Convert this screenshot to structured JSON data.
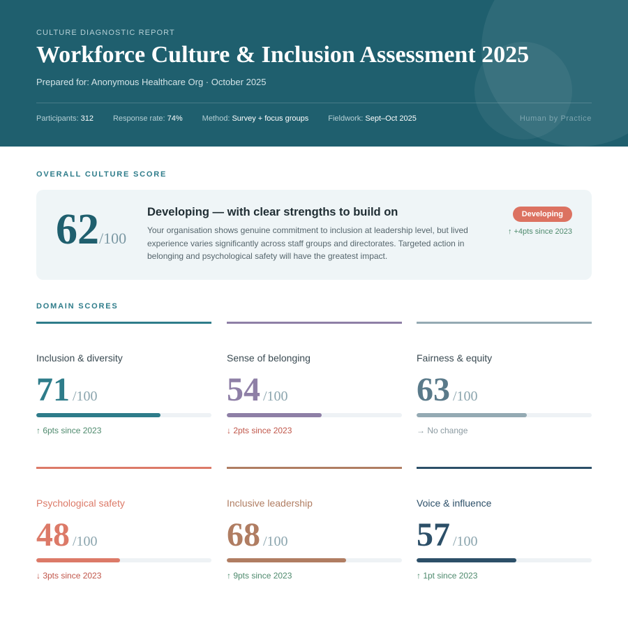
{
  "header": {
    "eyebrow": "CULTURE DIAGNOSTIC REPORT",
    "title": "Workforce Culture & Inclusion Assessment 2025",
    "prepared": "Prepared for: Anonymous Healthcare Org · October 2025",
    "meta": [
      {
        "label": "Participants:",
        "value": "312"
      },
      {
        "label": "Response rate:",
        "value": "74%"
      },
      {
        "label": "Method:",
        "value": "Survey + focus groups"
      },
      {
        "label": "Fieldwork:",
        "value": "Sept–Oct 2025"
      }
    ],
    "brand": "Human by Practice"
  },
  "overall": {
    "section_title": "OVERALL CULTURE SCORE",
    "score": "62",
    "out_of": "/100",
    "heading": "Developing — with clear strengths to build on",
    "description": "Your organisation shows genuine commitment to inclusion at leadership level, but lived experience varies significantly across staff groups and directorates. Targeted action in belonging and psychological safety will have the greatest impact.",
    "badge": "Developing",
    "change": "↑ +4pts since 2023"
  },
  "domains_section_title": "DOMAIN SCORES",
  "domains": [
    {
      "name": "Inclusion & diversity",
      "score": "71",
      "out_of": "/100",
      "value": 71,
      "change": "↑ 6pts since 2023",
      "trend": "up",
      "color": "#2e7c8a",
      "name_color": "#3a4a52"
    },
    {
      "name": "Sense of belonging",
      "score": "54",
      "out_of": "/100",
      "value": 54,
      "change": "↓ 2pts since 2023",
      "trend": "down",
      "color": "#8e7fa6",
      "name_color": "#3a4a52"
    },
    {
      "name": "Fairness & equity",
      "score": "63",
      "out_of": "/100",
      "value": 63,
      "change": "→ No change",
      "trend": "flat",
      "color": "#5a7a8a",
      "bar_color": "#94aab3",
      "name_color": "#3a4a52"
    },
    {
      "name": "Psychological safety",
      "score": "48",
      "out_of": "/100",
      "value": 48,
      "change": "↓ 3pts since 2023",
      "trend": "down",
      "color": "#dc7a68",
      "name_color": "#dc7a68"
    },
    {
      "name": "Inclusive leadership",
      "score": "68",
      "out_of": "/100",
      "value": 68,
      "change": "↑ 9pts since 2023",
      "trend": "up",
      "color": "#b07d62",
      "name_color": "#b07d62"
    },
    {
      "name": "Voice & influence",
      "score": "57",
      "out_of": "/100",
      "value": 57,
      "change": "↑ 1pt since 2023",
      "trend": "up",
      "color": "#2c4f68",
      "name_color": "#2c4f68"
    }
  ]
}
